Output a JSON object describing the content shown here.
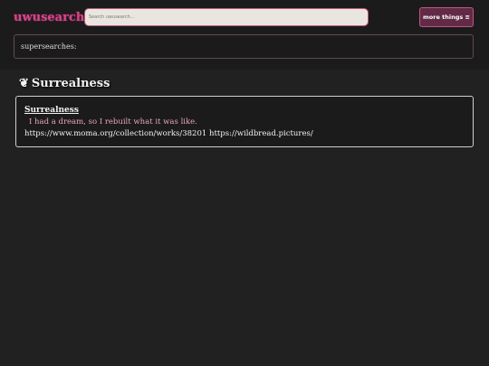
{
  "header": {
    "logo": "uwusearch",
    "search": {
      "placeholder": "Search uwusearch...",
      "value": ""
    },
    "more_button": "more things ≡"
  },
  "supersearches": {
    "label": "supersearches:"
  },
  "section": {
    "icon": "❦",
    "title": "Surrealness"
  },
  "result": {
    "title": "Surrealness",
    "description": "I had a dream, so I rebuilt what it was like.",
    "links": [
      "https://www.moma.org/collection/works/38201",
      "https://wildbread.pictures/"
    ]
  },
  "colors": {
    "background": "#212121",
    "accent": "#d9468b",
    "button": "#622a46",
    "description": "#e8a3c2"
  }
}
